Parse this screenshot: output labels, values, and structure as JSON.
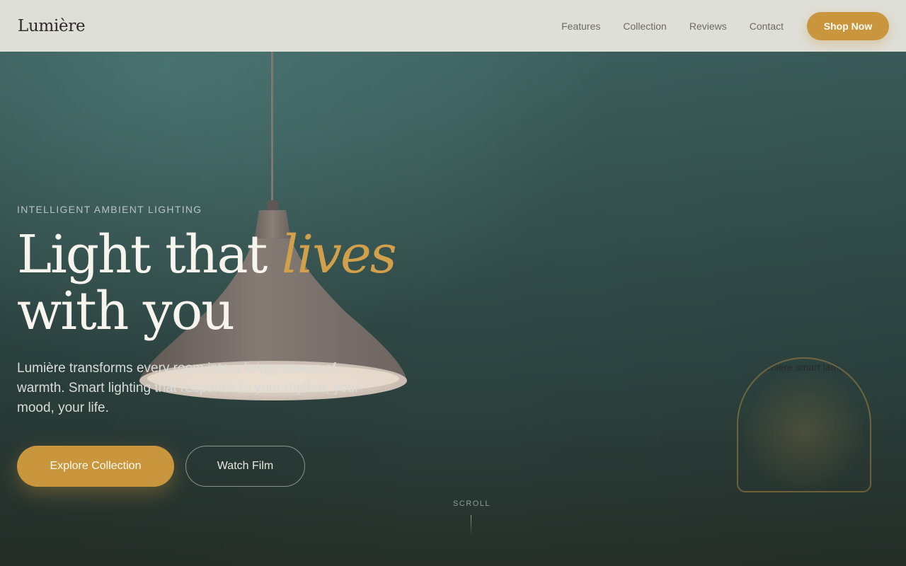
{
  "brand": {
    "logo_text": "Lumière"
  },
  "nav": {
    "links": [
      "Features",
      "Collection",
      "Reviews",
      "Contact"
    ],
    "cta_label": "Shop Now"
  },
  "hero": {
    "eyebrow": "INTELLIGENT AMBIENT LIGHTING",
    "headline_part1": "Light that ",
    "headline_accent": "lives",
    "headline_part2": "with you",
    "description": "Lumière transforms every room into a living canvas of warmth. Smart lighting that responds to your rhythm, your mood, your life.",
    "primary_cta": "Explore Collection",
    "secondary_cta": "Watch Film"
  },
  "scroll_indicator": {
    "label": "SCROLL"
  },
  "arch_card": {
    "label": "Lumière smart lamp"
  },
  "colors": {
    "accent": "#c9963d",
    "navbar_bg": "#dfdfd9",
    "hero_bg": "#35524f",
    "headline": "#f7f4ee",
    "headline_accent": "#d2a04a"
  }
}
